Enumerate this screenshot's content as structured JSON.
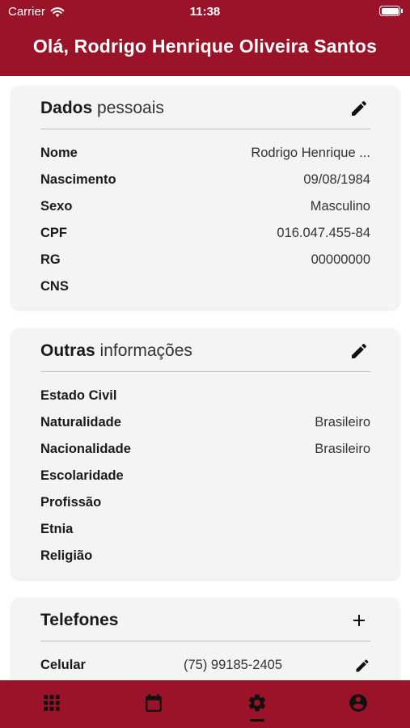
{
  "status_bar": {
    "carrier": "Carrier",
    "time": "11:38"
  },
  "header": {
    "greeting": "Olá, Rodrigo Henrique Oliveira Santos"
  },
  "personal": {
    "title_strong": "Dados",
    "title_light": " pessoais",
    "rows": [
      {
        "label": "Nome",
        "value": "Rodrigo Henrique ..."
      },
      {
        "label": "Nascimento",
        "value": "09/08/1984"
      },
      {
        "label": "Sexo",
        "value": "Masculino"
      },
      {
        "label": "CPF",
        "value": "016.047.455-84"
      },
      {
        "label": "RG",
        "value": "00000000"
      },
      {
        "label": "CNS",
        "value": ""
      }
    ]
  },
  "other": {
    "title_strong": "Outras",
    "title_light": " informações",
    "rows": [
      {
        "label": "Estado Civil",
        "value": ""
      },
      {
        "label": "Naturalidade",
        "value": "Brasileiro"
      },
      {
        "label": "Nacionalidade",
        "value": "Brasileiro"
      },
      {
        "label": "Escolaridade",
        "value": ""
      },
      {
        "label": "Profissão",
        "value": ""
      },
      {
        "label": "Etnia",
        "value": ""
      },
      {
        "label": "Religião",
        "value": ""
      }
    ]
  },
  "phones": {
    "title": "Telefones",
    "items": [
      {
        "label": "Celular",
        "value": "(75) 99185-2405"
      }
    ]
  },
  "tabbar": {
    "tabs": [
      "grid-icon",
      "calendar-icon",
      "settings-icon",
      "account-circle-icon"
    ],
    "active": 2
  },
  "colors": {
    "brand": "#9b1328",
    "card_bg": "#f4f4f4"
  }
}
